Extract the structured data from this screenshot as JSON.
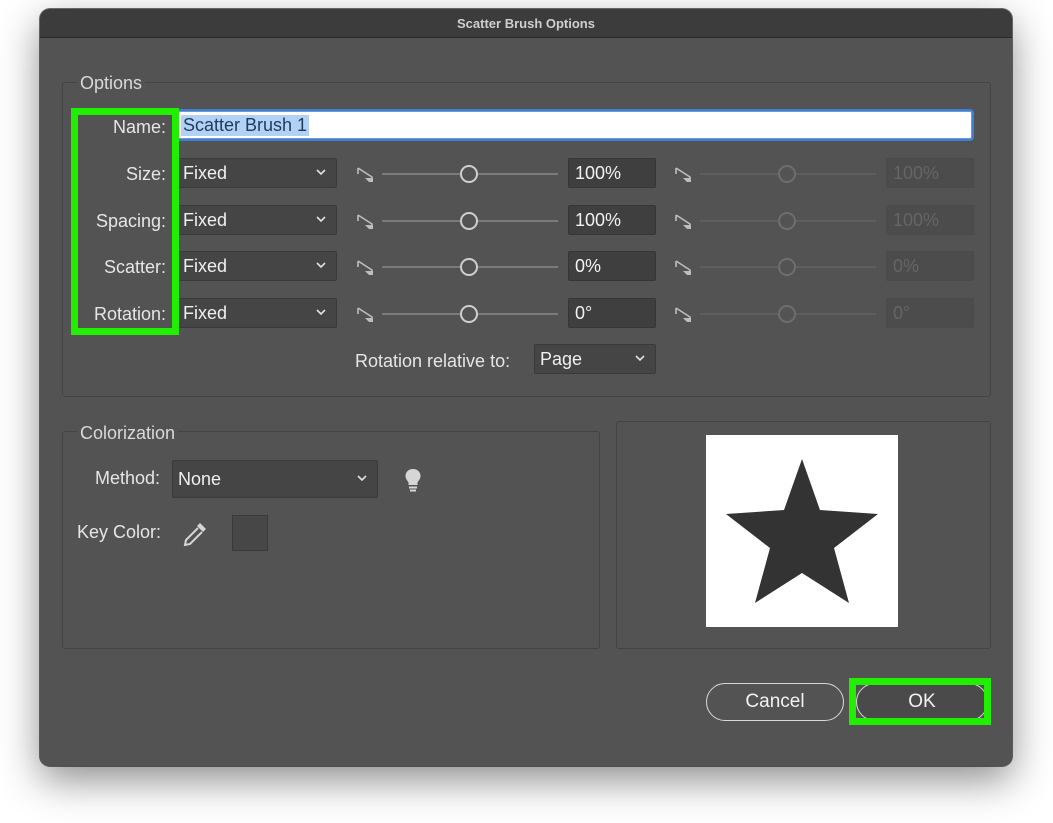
{
  "window": {
    "title": "Scatter Brush Options"
  },
  "options": {
    "title": "Options",
    "name_label": "Name:",
    "name_value": "Scatter Brush 1",
    "rows": [
      {
        "label": "Size:",
        "method": "Fixed",
        "value": "100%",
        "value2": "100%"
      },
      {
        "label": "Spacing:",
        "method": "Fixed",
        "value": "100%",
        "value2": "100%"
      },
      {
        "label": "Scatter:",
        "method": "Fixed",
        "value": "0%",
        "value2": "0%"
      },
      {
        "label": "Rotation:",
        "method": "Fixed",
        "value": "0°",
        "value2": "0°"
      }
    ],
    "rotation_relative_label": "Rotation relative to:",
    "rotation_relative_value": "Page"
  },
  "colorization": {
    "title": "Colorization",
    "method_label": "Method:",
    "method_value": "None",
    "key_color_label": "Key Color:"
  },
  "buttons": {
    "cancel": "Cancel",
    "ok": "OK"
  },
  "colors": {
    "dialog_bg": "#535353",
    "highlight": "#22ee00",
    "star": "#333333"
  }
}
